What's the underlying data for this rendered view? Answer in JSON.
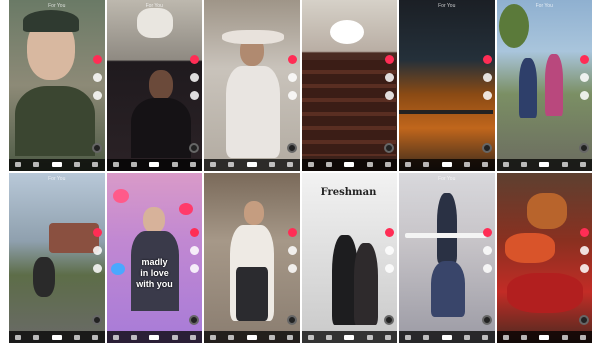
{
  "tiles": [
    {
      "id": "t1",
      "top_label": "For You",
      "overlay": ""
    },
    {
      "id": "t2",
      "top_label": "For You",
      "overlay": ""
    },
    {
      "id": "t3",
      "top_label": "",
      "overlay": ""
    },
    {
      "id": "t4",
      "top_label": "",
      "overlay": ""
    },
    {
      "id": "t5",
      "top_label": "For You",
      "overlay": ""
    },
    {
      "id": "t6",
      "top_label": "For You",
      "overlay": ""
    },
    {
      "id": "t7",
      "top_label": "For You",
      "overlay": ""
    },
    {
      "id": "t8",
      "top_label": "",
      "overlay": "madly\nin love\nwith you"
    },
    {
      "id": "t9",
      "top_label": "",
      "overlay": ""
    },
    {
      "id": "t10",
      "top_label": "",
      "overlay": "Freshman"
    },
    {
      "id": "t11",
      "top_label": "For You",
      "overlay": ""
    },
    {
      "id": "t12",
      "top_label": "",
      "overlay": ""
    }
  ],
  "colors": {
    "heart": "#ff2d55",
    "nav_bar": "#000000"
  },
  "icons": [
    "heart-icon",
    "comment-icon",
    "share-icon",
    "music-disc-icon",
    "home-icon",
    "search-icon",
    "add-icon",
    "inbox-icon",
    "profile-icon"
  ]
}
